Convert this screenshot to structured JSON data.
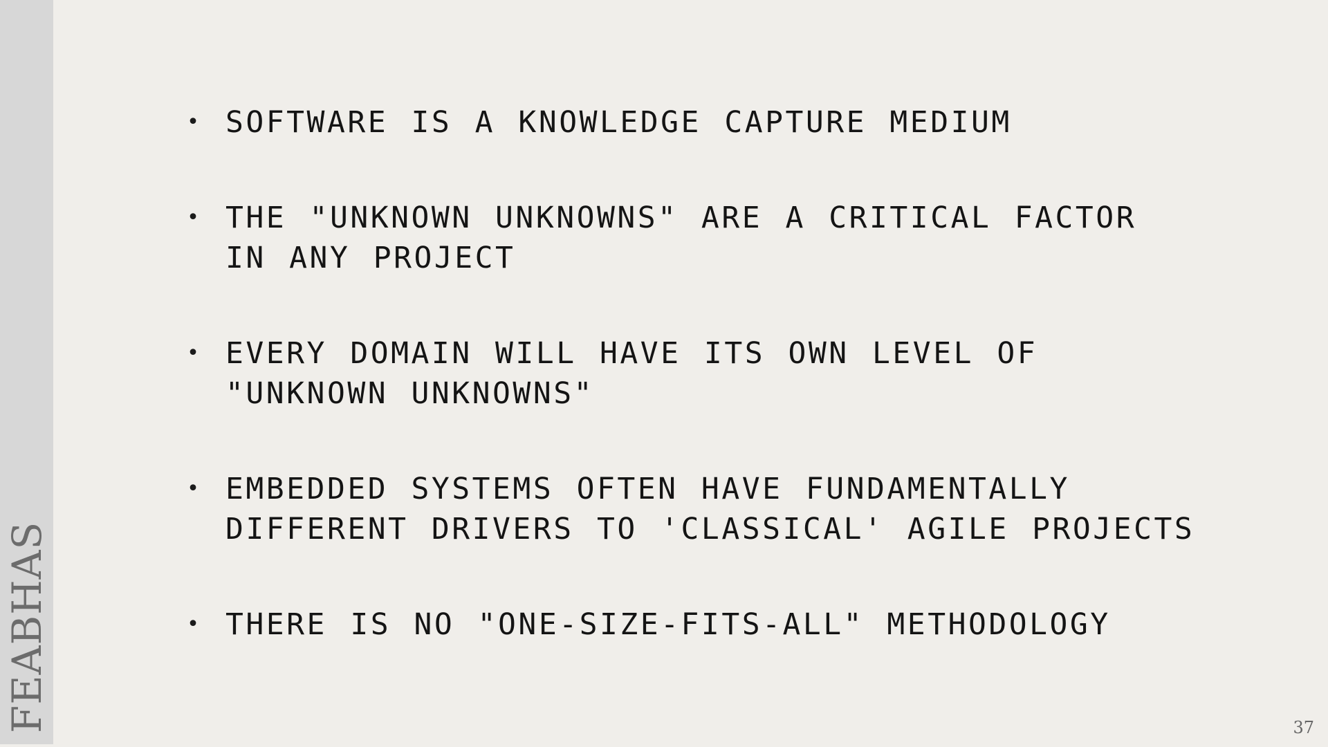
{
  "sidebar": {
    "logo_text": "FEABHAS"
  },
  "bullets": [
    {
      "text": "SOFTWARE IS A KNOWLEDGE CAPTURE MEDIUM"
    },
    {
      "text": "THE \"UNKNOWN UNKNOWNS\" ARE A CRITICAL FACTOR IN ANY PROJECT"
    },
    {
      "text": "EVERY DOMAIN WILL HAVE ITS OWN LEVEL OF \"UNKNOWN UNKNOWNS\""
    },
    {
      "text": "EMBEDDED SYSTEMS OFTEN HAVE FUNDAMENTALLY DIFFERENT DRIVERS TO 'CLASSICAL' AGILE PROJECTS"
    },
    {
      "text": "THERE IS NO \"ONE-SIZE-FITS-ALL\" METHODOLOGY"
    }
  ],
  "footer": {
    "page_number": "37"
  }
}
